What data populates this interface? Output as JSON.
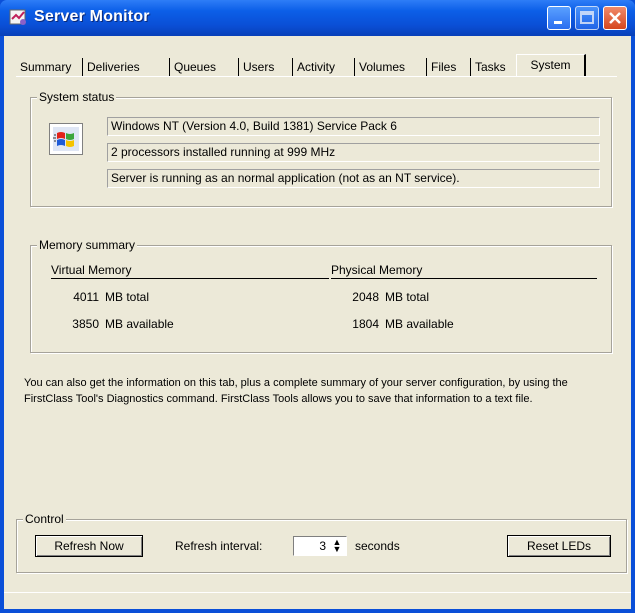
{
  "window": {
    "title": "Server Monitor"
  },
  "tabs": [
    "Summary",
    "Deliveries",
    "Queues",
    "Users",
    "Activity",
    "Volumes",
    "Files",
    "Tasks",
    "System"
  ],
  "active_tab": "System",
  "system_status": {
    "label": "System status",
    "os": "Windows NT (Version 4.0, Build 1381) Service Pack 6",
    "processors": "2 processors installed running at 999 MHz",
    "mode": "Server is running as an normal application (not as an NT service)."
  },
  "memory": {
    "label": "Memory summary",
    "virtual": {
      "heading": "Virtual Memory",
      "total": "4011",
      "total_unit": "MB total",
      "available": "3850",
      "available_unit": "MB available"
    },
    "physical": {
      "heading": "Physical Memory",
      "total": "2048",
      "total_unit": "MB total",
      "available": "1804",
      "available_unit": "MB available"
    }
  },
  "info": "You can also get the information on this tab, plus a complete summary of your server configuration, by using the FirstClass Tool's Diagnostics command. FirstClass Tools allows you to save that information to a text file.",
  "control": {
    "label": "Control",
    "refresh_button": "Refresh Now",
    "interval_label": "Refresh interval:",
    "interval_value": "3",
    "interval_unit": "seconds",
    "reset_button": "Reset LEDs"
  },
  "icons": {
    "app": "server-monitor-icon",
    "system": "windows-logo-icon"
  },
  "colors": {
    "titlebar": "#0a4fd8",
    "face": "#ece9d8",
    "close": "#d6461e"
  }
}
